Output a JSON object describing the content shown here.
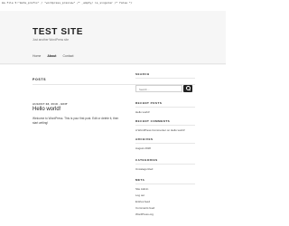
{
  "topbar": {
    "text": "me.file 5:\"meta_prefix\" / \"wordpress_preview\" /* _empty/ is_singular /* false */"
  },
  "header": {
    "title": "TEST SITE",
    "tagline": "Just another WordPress site",
    "nav": [
      {
        "label": "Home"
      },
      {
        "label": "About"
      },
      {
        "label": "Contact"
      }
    ]
  },
  "section": {
    "label": "POSTS"
  },
  "post": {
    "meta": "AUGUST 28, 2018 · EDIT",
    "title": "Hello world!",
    "excerpt": "Welcome to WordPress. This is your first post. Edit or delete it, then start writing!"
  },
  "sidebar": {
    "search": {
      "title": "SEARCH",
      "placeholder": "Search ..."
    },
    "recent_posts": {
      "title": "RECENT POSTS",
      "items": [
        "Hello world!"
      ]
    },
    "recent_comments": {
      "title": "RECENT COMMENTS",
      "items": [
        "A WordPress Commenter on Hello world!"
      ]
    },
    "archives": {
      "title": "ARCHIVES",
      "items": [
        "August 2018"
      ]
    },
    "categories": {
      "title": "CATEGORIES",
      "items": [
        "Uncategorized"
      ]
    },
    "meta": {
      "title": "META",
      "items": [
        "Site Admin",
        "Log out",
        "Entries feed",
        "Comments feed",
        "WordPress.org"
      ]
    }
  }
}
